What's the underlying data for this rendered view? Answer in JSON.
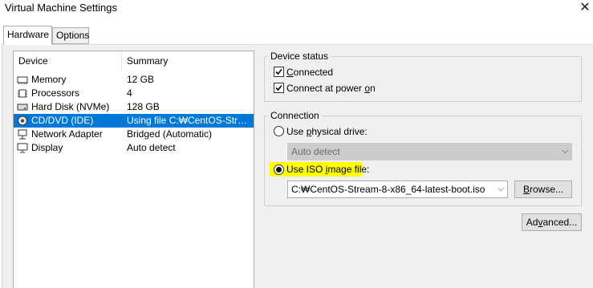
{
  "window": {
    "title": "Virtual Machine Settings",
    "close_glyph": "✕"
  },
  "tabs": [
    {
      "label": "Hardware",
      "active": true
    },
    {
      "label": "Options",
      "active": false
    }
  ],
  "device_list": {
    "headers": {
      "device": "Device",
      "summary": "Summary"
    },
    "rows": [
      {
        "icon": "memory-icon",
        "device": "Memory",
        "summary": "12 GB",
        "selected": false
      },
      {
        "icon": "processor-icon",
        "device": "Processors",
        "summary": "4",
        "selected": false
      },
      {
        "icon": "hard-disk-icon",
        "device": "Hard Disk (NVMe)",
        "summary": "128 GB",
        "selected": false
      },
      {
        "icon": "cd-dvd-icon",
        "device": "CD/DVD (IDE)",
        "summary": "Using file C:₩CentOS-Strea...",
        "selected": true
      },
      {
        "icon": "network-adapter-icon",
        "device": "Network Adapter",
        "summary": "Bridged (Automatic)",
        "selected": false
      },
      {
        "icon": "display-icon",
        "device": "Display",
        "summary": "Auto detect",
        "selected": false
      }
    ]
  },
  "device_status": {
    "title": "Device status",
    "connected": {
      "label_pre": "",
      "label_key": "C",
      "label_post": "onnected",
      "checked": true
    },
    "connect_at_power_on": {
      "label_pre": "Connect at power ",
      "label_key": "o",
      "label_post": "n",
      "checked": true
    }
  },
  "connection": {
    "title": "Connection",
    "physical": {
      "label_pre": "Use ",
      "label_key": "p",
      "label_post": "hysical drive:",
      "selected": false
    },
    "physical_drive_value": "Auto detect",
    "iso": {
      "label_pre": "Use ISO ",
      "label_key": "i",
      "label_post": "mage file:",
      "selected": true
    },
    "iso_path": "C:₩CentOS-Stream-8-x86_64-latest-boot.iso",
    "browse": {
      "key": "B",
      "rest": "rowse..."
    }
  },
  "advanced": {
    "pre": "Ad",
    "key": "v",
    "post": "anced..."
  },
  "colors": {
    "selection": "#0078d7",
    "highlight": "#ffff00",
    "panel": "#f0f0f0"
  }
}
